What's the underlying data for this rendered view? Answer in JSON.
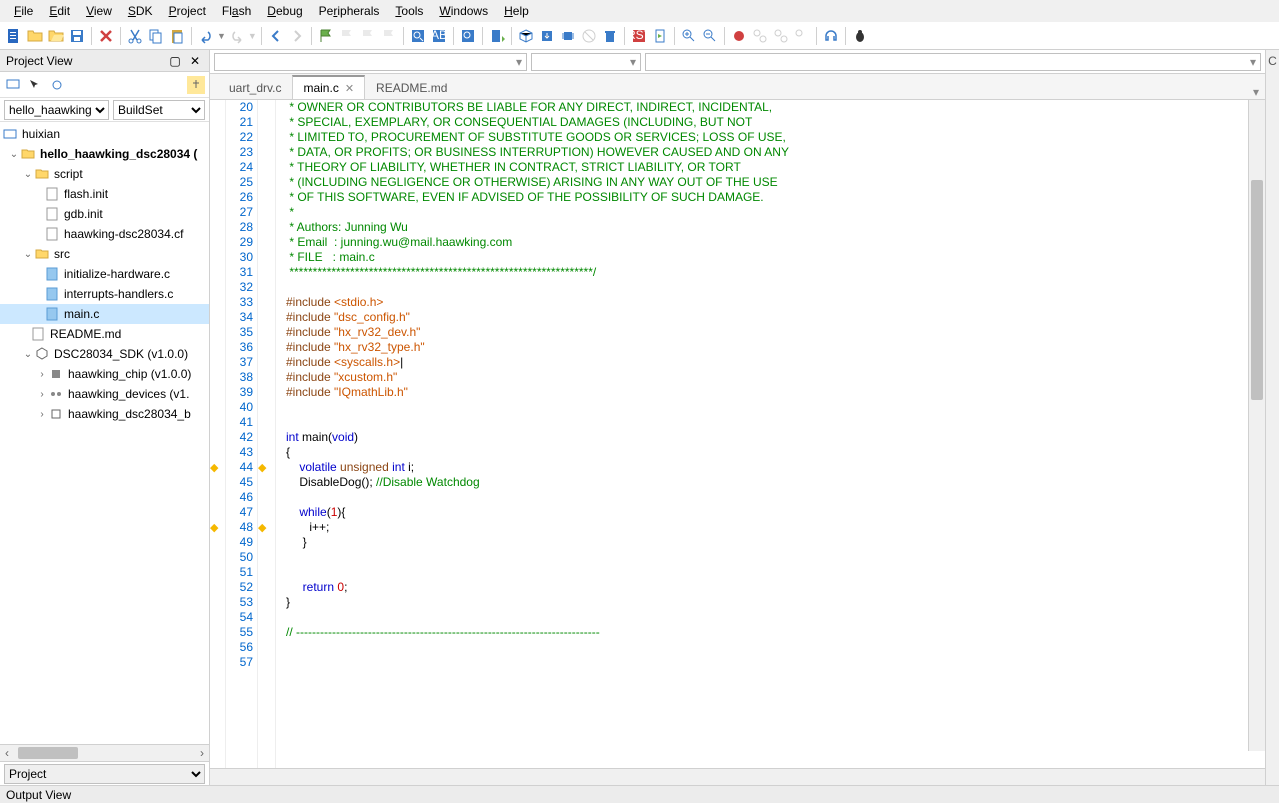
{
  "menu": [
    "File",
    "Edit",
    "View",
    "SDK",
    "Project",
    "Flash",
    "Debug",
    "Peripherals",
    "Tools",
    "Windows",
    "Help"
  ],
  "panels": {
    "project_view": "Project View",
    "output_view": "Output View"
  },
  "proj_select": {
    "a": "hello_haawking",
    "b": "BuildSet"
  },
  "tree": {
    "root": "huixian",
    "project": "hello_haawking_dsc28034 (",
    "script": "script",
    "flash": "flash.init",
    "gdb": "gdb.init",
    "cfg": "haawking-dsc28034.cf",
    "src": "src",
    "hw": "initialize-hardware.c",
    "int": "interrupts-handlers.c",
    "main": "main.c",
    "readme": "README.md",
    "sdk": "DSC28034_SDK (v1.0.0)",
    "chip": "haawking_chip (v1.0.0)",
    "dev": "haawking_devices (v1.",
    "dsc": "haawking_dsc28034_b"
  },
  "bottom_select": "Project",
  "tabs": [
    "uart_drv.c",
    "main.c",
    "README.md"
  ],
  "lines_start": 20,
  "code": [
    {
      "t": " * OWNER OR CONTRIBUTORS BE LIABLE FOR ANY DIRECT, INDIRECT, INCIDENTAL,",
      "cls": "c-comment"
    },
    {
      "t": " * SPECIAL, EXEMPLARY, OR CONSEQUENTIAL DAMAGES (INCLUDING, BUT NOT",
      "cls": "c-comment"
    },
    {
      "t": " * LIMITED TO, PROCUREMENT OF SUBSTITUTE GOODS OR SERVICES; LOSS OF USE,",
      "cls": "c-comment"
    },
    {
      "t": " * DATA, OR PROFITS; OR BUSINESS INTERRUPTION) HOWEVER CAUSED AND ON ANY",
      "cls": "c-comment"
    },
    {
      "t": " * THEORY OF LIABILITY, WHETHER IN CONTRACT, STRICT LIABILITY, OR TORT",
      "cls": "c-comment"
    },
    {
      "t": " * (INCLUDING NEGLIGENCE OR OTHERWISE) ARISING IN ANY WAY OUT OF THE USE",
      "cls": "c-comment"
    },
    {
      "t": " * OF THIS SOFTWARE, EVEN IF ADVISED OF THE POSSIBILITY OF SUCH DAMAGE.",
      "cls": "c-comment"
    },
    {
      "t": " *",
      "cls": "c-comment"
    },
    {
      "t": " * Authors: Junning Wu",
      "cls": "c-comment"
    },
    {
      "t": " * Email  : junning.wu@mail.haawking.com",
      "cls": "c-comment"
    },
    {
      "t": " * FILE   : main.c",
      "cls": "c-comment"
    },
    {
      "t": " *****************************************************************/",
      "cls": "c-comment"
    },
    {
      "t": "",
      "cls": ""
    },
    {
      "html": "<span class='c-pre'>#include</span> <span class='c-inc'>&lt;stdio.h&gt;</span>"
    },
    {
      "html": "<span class='c-pre'>#include</span> <span class='c-inc'>\"dsc_config.h\"</span>"
    },
    {
      "html": "<span class='c-pre'>#include</span> <span class='c-inc'>\"hx_rv32_dev.h\"</span>"
    },
    {
      "html": "<span class='c-pre'>#include</span> <span class='c-inc'>\"hx_rv32_type.h\"</span>"
    },
    {
      "html": "<span class='c-pre'>#include</span> <span class='c-inc'>&lt;syscalls.h&gt;</span>|"
    },
    {
      "html": "<span class='c-pre'>#include</span> <span class='c-inc'>\"xcustom.h\"</span>"
    },
    {
      "html": "<span class='c-pre'>#include</span> <span class='c-inc'>\"IQmathLib.h\"</span>"
    },
    {
      "t": "",
      "cls": ""
    },
    {
      "t": "",
      "cls": ""
    },
    {
      "html": "<span class='c-kw'>int</span> main(<span class='c-kw'>void</span>)"
    },
    {
      "t": "{",
      "cls": ""
    },
    {
      "html": "    <span class='c-kw'>volatile</span> <span class='c-type'>unsigned</span> <span class='c-kw'>int</span> i;",
      "bp": true
    },
    {
      "html": "    DisableDog(); <span class='c-comment'>//Disable Watchdog</span>"
    },
    {
      "t": "",
      "cls": ""
    },
    {
      "html": "    <span class='c-kw'>while</span>(<span class='c-num'>1</span>){"
    },
    {
      "t": "       i++;",
      "cls": "",
      "bp": true
    },
    {
      "t": "     }",
      "cls": ""
    },
    {
      "t": "",
      "cls": ""
    },
    {
      "t": "",
      "cls": ""
    },
    {
      "html": "     <span class='c-kw'>return</span> <span class='c-num'>0</span>;"
    },
    {
      "t": "}",
      "cls": ""
    },
    {
      "t": "",
      "cls": ""
    },
    {
      "html": "<span class='c-comment'>// ----------------------------------------------------------------------------</span>"
    },
    {
      "t": "",
      "cls": ""
    },
    {
      "t": "",
      "cls": ""
    }
  ]
}
